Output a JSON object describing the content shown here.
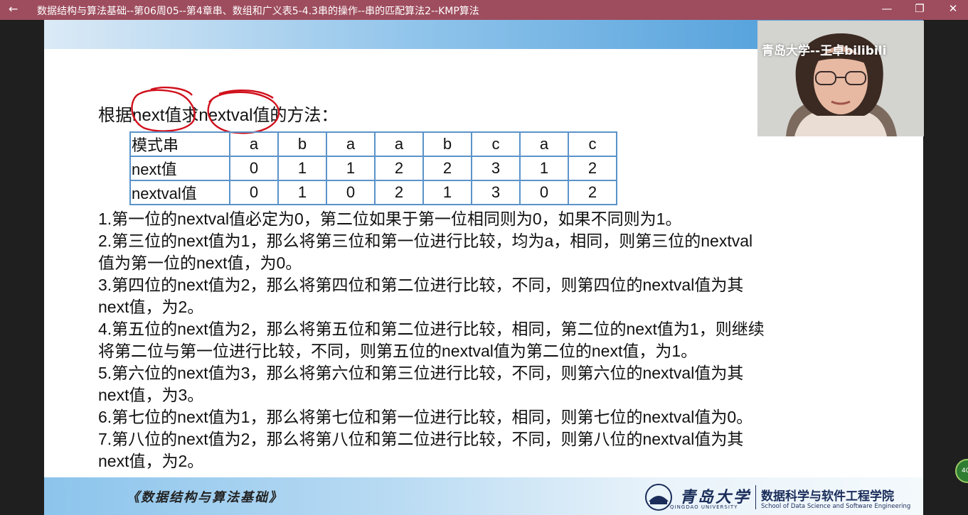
{
  "window": {
    "title": "数据结构与算法基础--第06周05--第4章串、数组和广义表5-4.3串的操作--串的匹配算法2--KMP算法",
    "back_icon": "←",
    "minimize_icon": "—",
    "restore_icon": "❐",
    "close_icon": "✕"
  },
  "slide": {
    "heading": "根据next值求nextval值的方法：",
    "table": {
      "rows": [
        {
          "label": "模式串",
          "cells": [
            "a",
            "b",
            "a",
            "a",
            "b",
            "c",
            "a",
            "c"
          ]
        },
        {
          "label": "next值",
          "cells": [
            "0",
            "1",
            "1",
            "2",
            "2",
            "3",
            "1",
            "2"
          ]
        },
        {
          "label": "nextval值",
          "cells": [
            "0",
            "1",
            "0",
            "2",
            "1",
            "3",
            "0",
            "2"
          ]
        }
      ]
    },
    "lines": [
      "1.第一位的nextval值必定为0，第二位如果于第一位相同则为0，如果不同则为1。",
      "2.第三位的next值为1，那么将第三位和第一位进行比较，均为a，相同，则第三位的nextval",
      "值为第一位的next值，为0。",
      "3.第四位的next值为2，那么将第四位和第二位进行比较，不同，则第四位的nextval值为其",
      "next值，为2。",
      "4.第五位的next值为2，那么将第五位和第二位进行比较，相同，第二位的next值为1，则继续",
      "将第二位与第一位进行比较，不同，则第五位的nextval值为第二位的next值，为1。",
      "5.第六位的next值为3，那么将第六位和第三位进行比较，不同，则第六位的nextval值为其",
      "next值，为3。",
      "6.第七位的next值为1，那么将第七位和第一位进行比较，相同，则第七位的nextval值为0。",
      "7.第八位的next值为2，那么将第八位和第二位进行比较，不同，则第八位的nextval值为其",
      "next值，为2。"
    ],
    "footer": {
      "course": "《数据结构与算法基础》",
      "university_cn": "青岛大学",
      "university_en": "QINGDAO UNIVERSITY",
      "school_cn": "数据科学与软件工程学院",
      "school_en": "School of Data Science and Software Engineering"
    }
  },
  "webcam": {
    "watermark": "青岛大学--王卓bilibili"
  },
  "badge": {
    "text": "40"
  },
  "colors": {
    "titlebar": "#9e4d5e",
    "table_border": "#5b93c9",
    "annotation": "#d0101c",
    "footer_text": "#1a2d5a"
  }
}
